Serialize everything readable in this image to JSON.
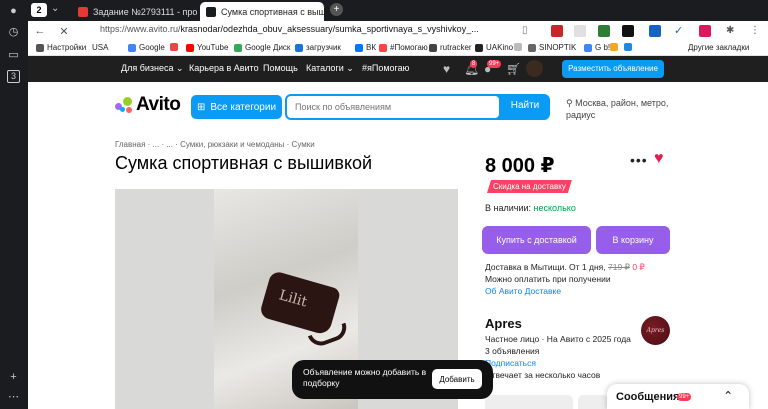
{
  "browser": {
    "tab_count": "2",
    "tabs": [
      {
        "title": "Задание №2793111 - про"
      },
      {
        "title": "Сумка спортивная с выш"
      }
    ],
    "new_tab_icon": "plus-icon",
    "url_prefix": "https://www.avito.ru/",
    "url_path": "krasnodar/odezhda_obuv_aksessuary/sumka_sportivnaya_s_vyshivkoy_...",
    "bookmarks": [
      {
        "label": "Настройки",
        "color": "#555"
      },
      {
        "label": "USA",
        "color": ""
      },
      {
        "label": "Google",
        "color": "#4285f4"
      },
      {
        "label": "",
        "color": "#e44"
      },
      {
        "label": "YouTube",
        "color": "#f00"
      },
      {
        "label": "Google Диск",
        "color": "#34a853"
      },
      {
        "label": "загрузчик",
        "color": "#1976d2"
      },
      {
        "label": "ВК",
        "color": "#0077ff"
      },
      {
        "label": "#Помогаю",
        "color": "#f44"
      },
      {
        "label": "rutracker",
        "color": "#444"
      },
      {
        "label": "UAKino",
        "color": "#222"
      },
      {
        "label": "",
        "color": "#bbb"
      },
      {
        "label": "SINOPTIK",
        "color": "#666"
      },
      {
        "label": "G b!",
        "color": "#4285f4"
      },
      {
        "label": "",
        "color": "#f5a623"
      },
      {
        "label": "",
        "color": "#1e88e5"
      },
      {
        "label": "Другие закладки",
        "color": ""
      }
    ]
  },
  "header": {
    "links": [
      "Для бизнеса",
      "Карьера в Авито",
      "Помощь",
      "Каталоги",
      "#яПомогаю"
    ],
    "notif_badge": "8",
    "messages_badge": "99+",
    "post_button": "Разместить объявление"
  },
  "search": {
    "logo": "Avito",
    "categories_button": "Все категории",
    "placeholder": "Поиск по объявлениям",
    "button": "Найти",
    "location": "Москва, район, метро, радиус"
  },
  "listing": {
    "breadcrumb": "Главная · ... · ... · Сумки, рюкзаки и чемоданы · Сумки",
    "title": "Сумка спортивная с вышивкой",
    "bag_text": "Lilit",
    "price": "8 000 ₽",
    "discount_badge": "Скидка на доставку",
    "stock_label": "В наличии:",
    "stock_value": "несколько",
    "buy_button": "Купить с доставкой",
    "cart_button": "В корзину",
    "delivery_line": "Доставка в Мытищи. От 1 дня,",
    "delivery_old_price": "719 ₽",
    "delivery_new_price": "0 ₽",
    "pay_on_receive": "Можно оплатить при получении",
    "about_delivery": "Об Авито Доставке"
  },
  "seller": {
    "name": "Apres",
    "info_line": "Частное лицо · На Авито с 2025 года",
    "listings": "3 объявления",
    "subscribe": "Подписаться",
    "response": "Отвечает за несколько часов",
    "avatar_text": "Apres"
  },
  "toast": {
    "text": "Объявление можно добавить в подборку",
    "button": "Добавить"
  },
  "messages_widget": {
    "label": "Сообщения",
    "badge": "99+"
  }
}
